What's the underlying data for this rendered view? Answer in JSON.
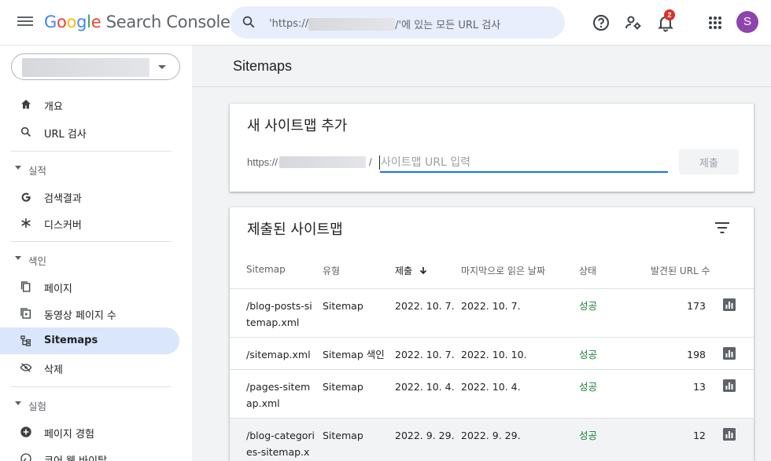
{
  "header": {
    "app_name": {
      "g1": "G",
      "o1": "o",
      "o2": "o",
      "g2": "g",
      "l": "l",
      "e": "e",
      "rest": " Search Console"
    },
    "search_placeholder_prefix": "'https://",
    "search_placeholder_suffix": "/'에 있는 모든 URL 검사",
    "notification_count": "2",
    "avatar_initial": "S"
  },
  "sidebar": {
    "items": [
      {
        "label": "개요",
        "icon": "home-icon"
      },
      {
        "label": "URL 검사",
        "icon": "search-icon"
      }
    ],
    "sections": [
      {
        "label": "실적",
        "items": [
          {
            "label": "검색결과",
            "icon": "google-g-icon"
          },
          {
            "label": "디스커버",
            "icon": "asterisk-icon"
          }
        ]
      },
      {
        "label": "색인",
        "items": [
          {
            "label": "페이지",
            "icon": "pages-icon"
          },
          {
            "label": "동영상 페이지 수",
            "icon": "video-page-icon"
          },
          {
            "label": "Sitemaps",
            "icon": "sitemap-icon"
          },
          {
            "label": "삭제",
            "icon": "removal-icon"
          }
        ]
      },
      {
        "label": "실험",
        "items": [
          {
            "label": "페이지 경험",
            "icon": "plus-circle-icon"
          },
          {
            "label": "코어 웹 바이탈",
            "icon": "gauge-icon"
          }
        ]
      }
    ]
  },
  "page": {
    "title": "Sitemaps"
  },
  "add_sitemap": {
    "title": "새 사이트맵 추가",
    "prefix": "https://",
    "separator": "/",
    "input_placeholder": "사이트맵 URL 입력",
    "submit_label": "제출"
  },
  "submitted": {
    "title": "제출된 사이트맵",
    "columns": [
      "Sitemap",
      "유형",
      "제출",
      "마지막으로 읽은 날짜",
      "상태",
      "발견된 URL 수"
    ],
    "rows": [
      {
        "sitemap": "/blog-posts-si\ntemap.xml",
        "type": "Sitemap",
        "submitted": "2022. 10. 7.",
        "last_read": "2022. 10. 7.",
        "status": "성공",
        "urls": "173"
      },
      {
        "sitemap": "/sitemap.xml",
        "type": "Sitemap 색인",
        "submitted": "2022. 10. 7.",
        "last_read": "2022. 10. 10.",
        "status": "성공",
        "urls": "198"
      },
      {
        "sitemap": "/pages-sitem\nap.xml",
        "type": "Sitemap",
        "submitted": "2022. 10. 4.",
        "last_read": "2022. 10. 4.",
        "status": "성공",
        "urls": "13"
      },
      {
        "sitemap": "/blog-categori\nes-sitemap.x",
        "type": "Sitemap",
        "submitted": "2022. 9. 29.",
        "last_read": "2022. 9. 29.",
        "status": "성공",
        "urls": "12"
      }
    ]
  },
  "colors": {
    "accent": "#1a73e8",
    "active_nav": "#d9e6fc",
    "success": "#188038",
    "avatar": "#8e44ad",
    "badge": "#d93025"
  }
}
